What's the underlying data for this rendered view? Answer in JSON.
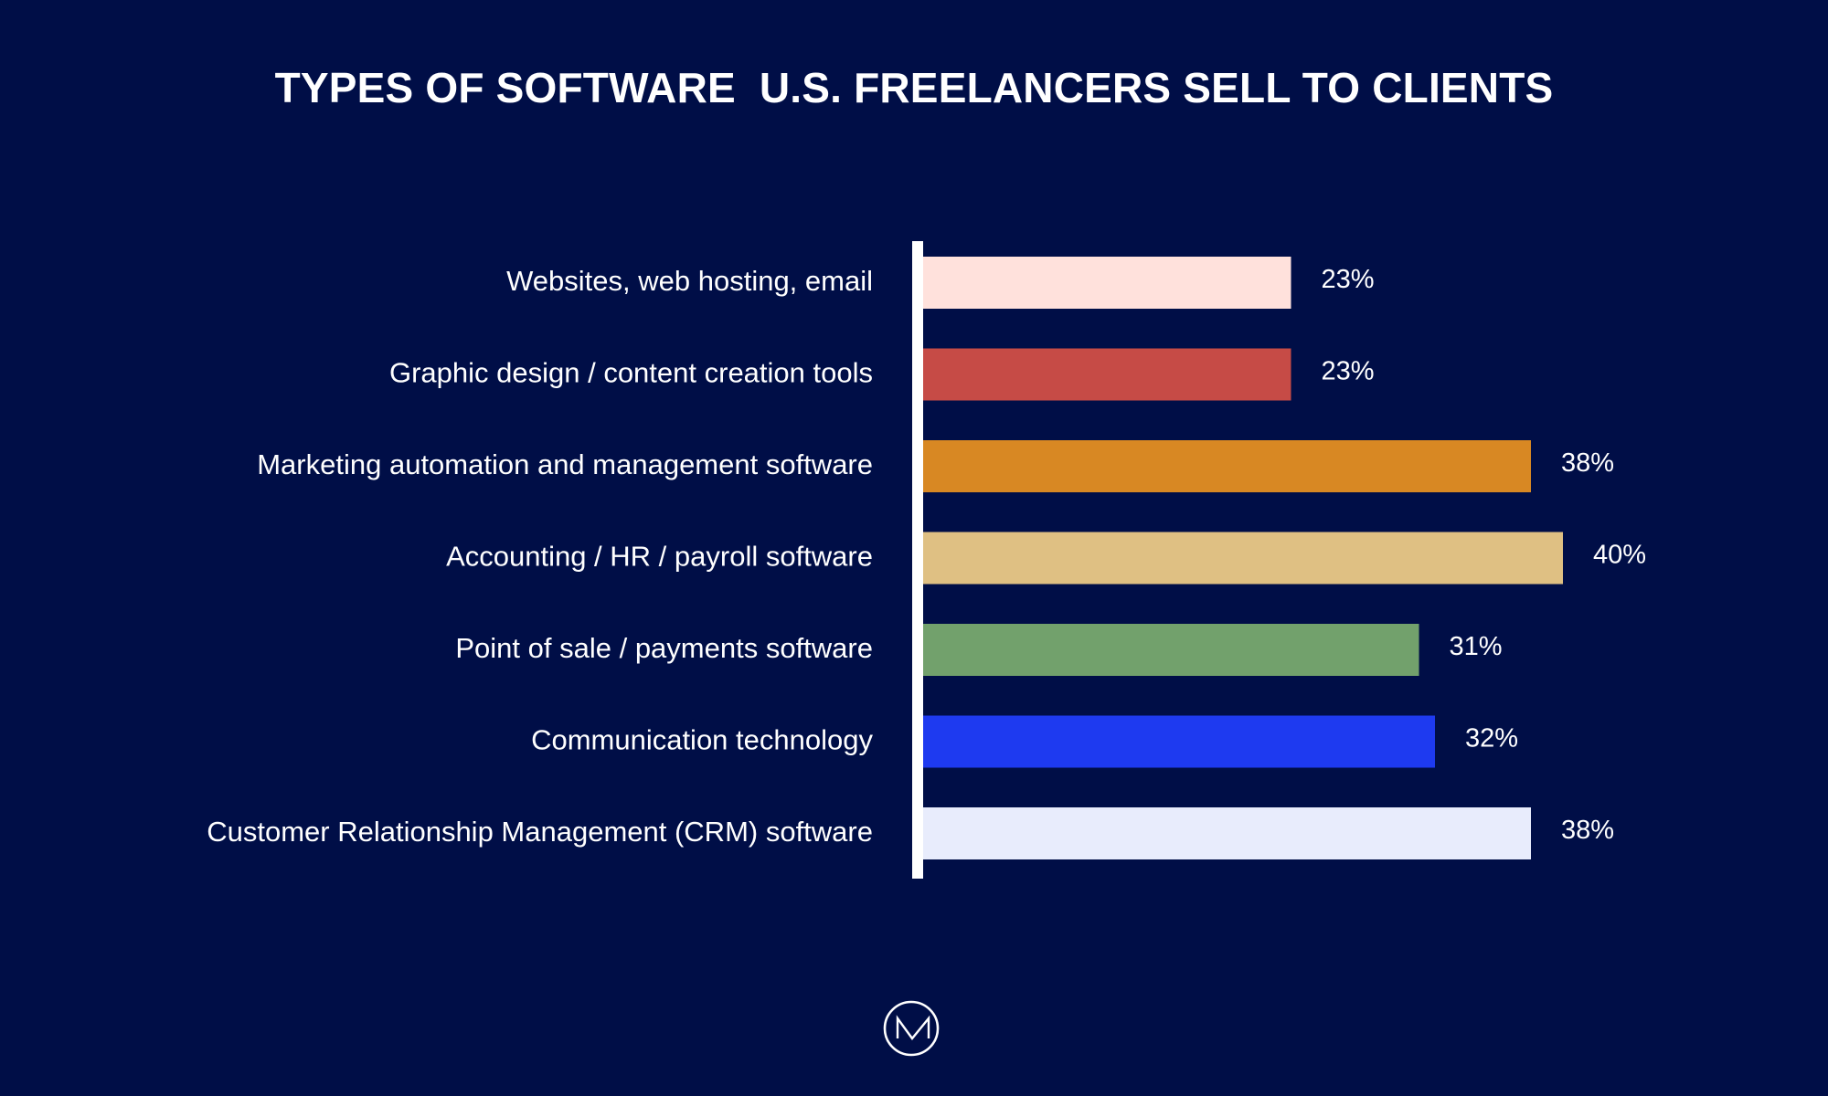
{
  "page": {
    "background": "#000E47",
    "logo": "nm-monogram-logo"
  },
  "chart_data": {
    "type": "bar",
    "orientation": "horizontal",
    "title": "TYPES OF SOFTWARE  U.S. FREELANCERS SELL TO CLIENTS",
    "xlabel": "",
    "ylabel": "",
    "unit": "%",
    "xlim": [
      0,
      40
    ],
    "grid": false,
    "legend": "none",
    "categories": [
      "Websites, web hosting, email",
      "Graphic design / content creation tools",
      "Marketing automation and management software",
      "Accounting / HR / payroll software",
      "Point of sale / payments software",
      "Communication technology",
      "Customer Relationship Management (CRM) software"
    ],
    "values": [
      23,
      23,
      38,
      40,
      31,
      32,
      38
    ],
    "value_labels": [
      "23%",
      "23%",
      "38%",
      "40%",
      "31%",
      "32%",
      "38%"
    ],
    "colors": [
      "#FFE1DC",
      "#C64B46",
      "#D88823",
      "#DFC083",
      "#72A16C",
      "#1E3AF0",
      "#E8ECFC"
    ]
  }
}
